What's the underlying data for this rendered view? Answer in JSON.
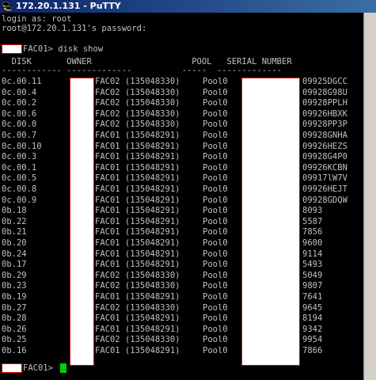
{
  "window": {
    "title": "172.20.1.131 - PuTTY"
  },
  "terminal": {
    "login_line": "login as: root",
    "password_line": "root@172.20.1.131's password:",
    "command_prompt_suffix": "FAC01> disk show",
    "header_line": "  DISK       OWNER                    POOL   SERIAL NUMBER",
    "divider_line": "------------ -------------          -----  -------------",
    "final_prompt_suffix": "FAC01> ",
    "rows": [
      {
        "disk": "0c.00.11",
        "owner": "FAC02 (135048330)",
        "pool": "Pool0",
        "serial": "09925DGCC"
      },
      {
        "disk": "0c.00.4",
        "owner": "FAC02 (135048330)",
        "pool": "Pool0",
        "serial": "09928G98U"
      },
      {
        "disk": "0c.00.2",
        "owner": "FAC02 (135048330)",
        "pool": "Pool0",
        "serial": "09928PPLH"
      },
      {
        "disk": "0c.00.6",
        "owner": "FAC02 (135048330)",
        "pool": "Pool0",
        "serial": "09926HBXK"
      },
      {
        "disk": "0c.00.0",
        "owner": "FAC02 (135048330)",
        "pool": "Pool0",
        "serial": "09928PP3P"
      },
      {
        "disk": "0c.00.7",
        "owner": "FAC01 (135048291)",
        "pool": "Pool0",
        "serial": "09928GNHA"
      },
      {
        "disk": "0c.00.10",
        "owner": "FAC01 (135048291)",
        "pool": "Pool0",
        "serial": "09926HEZS"
      },
      {
        "disk": "0c.00.3",
        "owner": "FAC01 (135048291)",
        "pool": "Pool0",
        "serial": "09928G4P0"
      },
      {
        "disk": "0c.00.1",
        "owner": "FAC01 (135048291)",
        "pool": "Pool0",
        "serial": "09926KCBN"
      },
      {
        "disk": "0c.00.5",
        "owner": "FAC01 (135048291)",
        "pool": "Pool0",
        "serial": "09917lW7V"
      },
      {
        "disk": "0c.00.8",
        "owner": "FAC01 (135048291)",
        "pool": "Pool0",
        "serial": "09926HEJT"
      },
      {
        "disk": "0c.00.9",
        "owner": "FAC01 (135048291)",
        "pool": "Pool0",
        "serial": "09928GDQW"
      },
      {
        "disk": "0b.18",
        "owner": "FAC01 (135048291)",
        "pool": "Pool0",
        "serial": "8093"
      },
      {
        "disk": "0b.22",
        "owner": "FAC01 (135048291)",
        "pool": "Pool0",
        "serial": "5587"
      },
      {
        "disk": "0b.21",
        "owner": "FAC01 (135048291)",
        "pool": "Pool0",
        "serial": "7856"
      },
      {
        "disk": "0b.20",
        "owner": "FAC01 (135048291)",
        "pool": "Pool0",
        "serial": "9600"
      },
      {
        "disk": "0b.24",
        "owner": "FAC01 (135048291)",
        "pool": "Pool0",
        "serial": "9114"
      },
      {
        "disk": "0b.17",
        "owner": "FAC01 (135048291)",
        "pool": "Pool0",
        "serial": "5493"
      },
      {
        "disk": "0b.29",
        "owner": "FAC02 (135048330)",
        "pool": "Pool0",
        "serial": "5049"
      },
      {
        "disk": "0b.23",
        "owner": "FAC02 (135048330)",
        "pool": "Pool0",
        "serial": "9807"
      },
      {
        "disk": "0b.19",
        "owner": "FAC01 (135048291)",
        "pool": "Pool0",
        "serial": "7641"
      },
      {
        "disk": "0b.27",
        "owner": "FAC02 (135048330)",
        "pool": "Pool0",
        "serial": "9645"
      },
      {
        "disk": "0b.28",
        "owner": "FAC01 (135048291)",
        "pool": "Pool0",
        "serial": "8194"
      },
      {
        "disk": "0b.26",
        "owner": "FAC01 (135048291)",
        "pool": "Pool0",
        "serial": "9342"
      },
      {
        "disk": "0b.25",
        "owner": "FAC02 (135048330)",
        "pool": "Pool0",
        "serial": "9954"
      },
      {
        "disk": "0b.16",
        "owner": "FAC01 (135048291)",
        "pool": "Pool0",
        "serial": "7866"
      }
    ]
  },
  "colors": {
    "terminal_background": "#000000",
    "terminal_text": "#c0c0c0",
    "cursor": "#00d000",
    "redaction_fill": "#ffffff",
    "redaction_border": "#dd0000"
  },
  "icons": {
    "app": "putty-icon"
  }
}
